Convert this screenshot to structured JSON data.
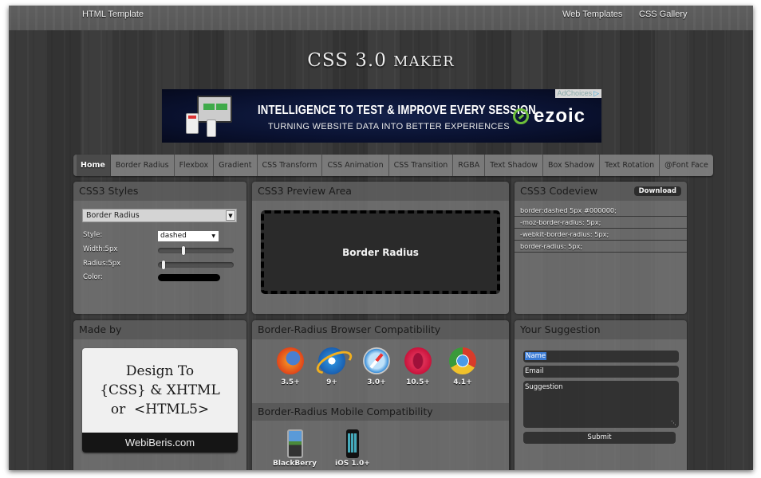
{
  "topbar": {
    "left_link": "HTML Template",
    "right_links": [
      "Web Templates",
      "CSS Gallery"
    ]
  },
  "site_title": {
    "prefix": "CSS 3.0 ",
    "suffix": "Maker"
  },
  "ad": {
    "headline": "INTELLIGENCE TO TEST & IMPROVE EVERY SESSION",
    "subline": "TURNING WEBSITE DATA INTO BETTER EXPERIENCES",
    "brand": "ezoic",
    "adchoices": "AdChoices",
    "brand_color": "#6dbf3a"
  },
  "tabs": [
    {
      "label": "Home",
      "active": true
    },
    {
      "label": "Border Radius"
    },
    {
      "label": "Flexbox"
    },
    {
      "label": "Gradient"
    },
    {
      "label": "CSS Transform"
    },
    {
      "label": "CSS Animation"
    },
    {
      "label": "CSS Transition"
    },
    {
      "label": "RGBA"
    },
    {
      "label": "Text Shadow"
    },
    {
      "label": "Box Shadow"
    },
    {
      "label": "Text Rotation"
    },
    {
      "label": "@Font Face"
    }
  ],
  "styles_panel": {
    "title": "CSS3 Styles",
    "selected_property": "Border Radius",
    "style_label": "Style:",
    "style_value": "dashed",
    "width_label": "Width:5px",
    "width_slider_fraction": 0.33,
    "radius_label": "Radius:5px",
    "radius_slider_fraction": 0.05,
    "color_label": "Color:",
    "color_value": "#000000"
  },
  "preview_panel": {
    "title": "CSS3 Preview Area",
    "preview_text": "Border Radius"
  },
  "code_panel": {
    "title": "CSS3 Codeview",
    "download_label": "Download",
    "lines": [
      "border:dashed 5px #000000;",
      "-moz-border-radius: 5px;",
      "-webkit-border-radius: 5px;",
      "border-radius: 5px;"
    ]
  },
  "made_panel": {
    "title": "Made by",
    "card_lines": [
      "Design To",
      "{CSS} & XHTML",
      "or  <HTML5>"
    ],
    "card_footer": "WebiBeris.com"
  },
  "compat_panel": {
    "title": "Border-Radius Browser Compatibility",
    "browsers": [
      {
        "name": "firefox-icon",
        "version": "3.5+"
      },
      {
        "name": "ie-icon",
        "version": "9+"
      },
      {
        "name": "safari-icon",
        "version": "3.0+"
      },
      {
        "name": "opera-icon",
        "version": "10.5+"
      },
      {
        "name": "chrome-icon",
        "version": "4.1+"
      }
    ],
    "mobile_title": "Border-Radius Mobile Compatibility",
    "mobile": [
      {
        "name": "blackberry-icon",
        "label": "BlackBerry"
      },
      {
        "name": "iphone-icon",
        "label": "iOS 1.0+"
      }
    ]
  },
  "suggest_panel": {
    "title": "Your Suggestion",
    "name_value": "Name",
    "email_value": "Email",
    "suggestion_value": "Suggestion",
    "submit_label": "Submit"
  }
}
